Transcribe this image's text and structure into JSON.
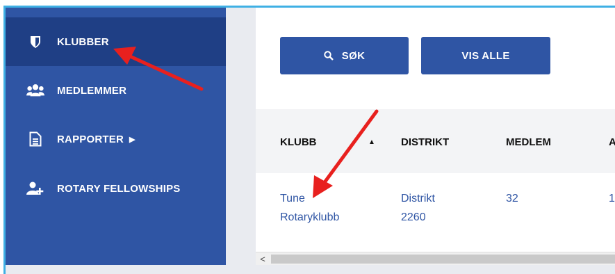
{
  "sidebar": {
    "items": [
      {
        "label": "KLUBBER",
        "icon": "shield-icon",
        "active": true
      },
      {
        "label": "MEDLEMMER",
        "icon": "users-icon",
        "active": false
      },
      {
        "label": "RAPPORTER",
        "icon": "document-icon",
        "active": false,
        "caret": "▶"
      },
      {
        "label": "ROTARY FELLOWSHIPS",
        "icon": "add-user-icon",
        "active": false
      }
    ]
  },
  "toolbar": {
    "search_label": "SØK",
    "show_all_label": "VIS ALLE"
  },
  "table": {
    "columns": [
      "KLUBB",
      "DISTRIKT",
      "MEDLEM",
      "A"
    ],
    "sort_indicator": "▲",
    "rows": [
      {
        "klubb_line1": "Tune",
        "klubb_line2": "Rotaryklubb",
        "distrikt_line1": "Distrikt",
        "distrikt_line2": "2260",
        "medlem": "32",
        "a": "1"
      }
    ]
  },
  "scrollbar": {
    "left_arrow": "<"
  },
  "colors": {
    "sidebar_bg": "#2f55a4",
    "sidebar_active": "#1f3f85",
    "button_bg": "#2f55a4",
    "link": "#2f55a4",
    "arrow": "#e8201e"
  }
}
